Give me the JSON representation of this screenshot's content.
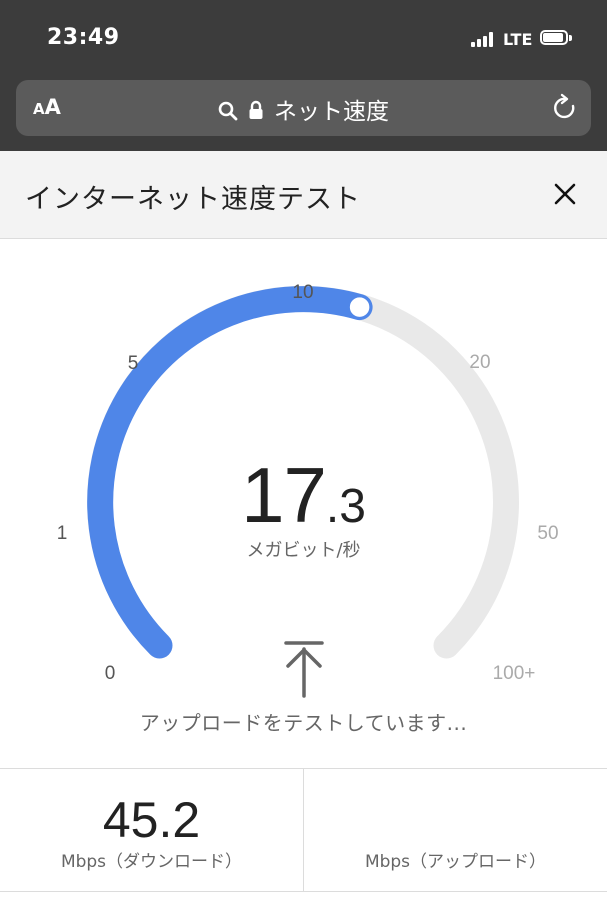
{
  "status_bar": {
    "time": "23:49",
    "network": "LTE"
  },
  "browser": {
    "text_size_small": "A",
    "text_size_big": "A",
    "url_text": "ネット速度",
    "icons": [
      "search-icon",
      "lock-icon",
      "reload-icon"
    ]
  },
  "sheet": {
    "title": "インターネット速度テスト",
    "close_icon": "close-icon"
  },
  "gauge": {
    "ticks": [
      "0",
      "1",
      "5",
      "10",
      "20",
      "50",
      "100+"
    ],
    "speed_integer": "17",
    "speed_decimal": ".3",
    "unit": "メガビット/秒",
    "status": "アップロードをテストしています...",
    "progress_fraction": 0.56,
    "colors": {
      "active": "#4f86e8",
      "track": "#e9e9e9"
    }
  },
  "results": {
    "download_value": "45.2",
    "download_label": "Mbps（ダウンロード）",
    "upload_value": "",
    "upload_label": "Mbps（アップロード）"
  }
}
